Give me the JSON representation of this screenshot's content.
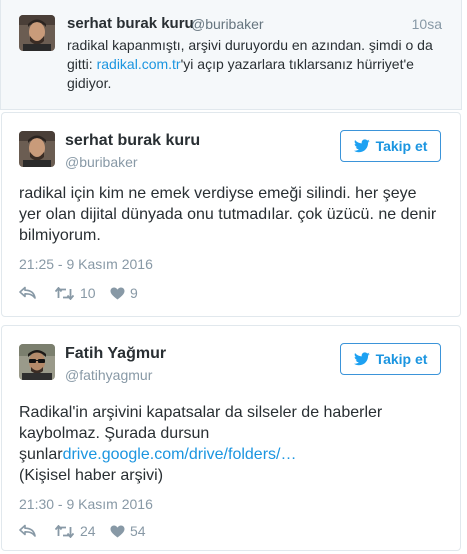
{
  "context_tweet": {
    "name": "serhat burak kuru",
    "handle": "@buribaker",
    "time": "10sa",
    "text_part1": "radikal kapanmıştı, arşivi duruyordu en azından. şimdi o da gitti: ",
    "link": "radikal.com.tr",
    "text_part2": "'yi açıp yazarlara tıklarsanız hürriyet'e gidiyor."
  },
  "tweet1": {
    "name": "serhat burak kuru",
    "handle": "@buribaker",
    "follow_label": "Takip et",
    "text": "radikal için kim ne emek verdiyse emeği silindi. her şeye yer olan dijital dünyada onu tutmadılar. çok üzücü. ne denir bilmiyorum.",
    "date": "21:25 - 9 Kasım 2016",
    "retweets": "10",
    "likes": "9"
  },
  "tweet2": {
    "name": "Fatih Yağmur",
    "handle": "@fatihyagmur",
    "follow_label": "Takip et",
    "text_line1": "Radikal'in arşivini kapatsalar da silseler de haberler kaybolmaz. Şurada dursun ",
    "text_prefix": "şunlar",
    "link": "drive.google.com/drive/folders/…",
    "text_line3": "(Kişisel haber arşivi)",
    "date": "21:30 - 9 Kasım 2016",
    "retweets": "24",
    "likes": "54"
  },
  "icons": {
    "follow": "twitter-bird-icon",
    "reply": "reply-icon",
    "retweet": "retweet-icon",
    "like": "heart-icon"
  },
  "colors": {
    "accent": "#1b95e0",
    "muted": "#8899a6",
    "context_bg": "#f5f8fa"
  }
}
